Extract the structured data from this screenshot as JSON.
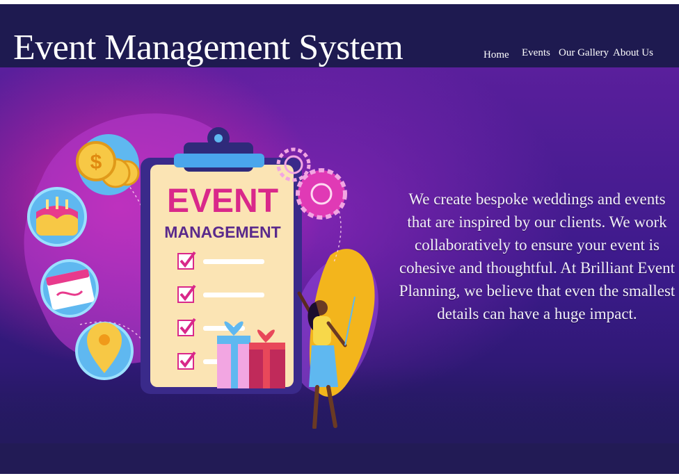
{
  "header": {
    "title": "Event Management System",
    "nav": {
      "home": "Home",
      "events": "Events",
      "gallery": "Our Gallery",
      "about": "About Us"
    }
  },
  "hero": {
    "illustration": {
      "clipboard_line1": "EVENT",
      "clipboard_line2": "MANAGEMENT",
      "icons": [
        "dollar-coins-icon",
        "birthday-cake-icon",
        "calendar-icon",
        "location-pin-icon",
        "gear-icon",
        "gift-box-icon",
        "checkbox-icon",
        "person-figure"
      ]
    },
    "intro": "We create bespoke weddings and events that are inspired by our clients. We work collaboratively to ensure your event is cohesive and thoughtful. At Brilliant Event Planning, we believe that even the smallest details can have a huge impact."
  },
  "colors": {
    "header_bg": "#1e1a50",
    "hero_pink": "#e828aa",
    "hero_purple": "#3b1a8a",
    "text": "#ffffff"
  }
}
